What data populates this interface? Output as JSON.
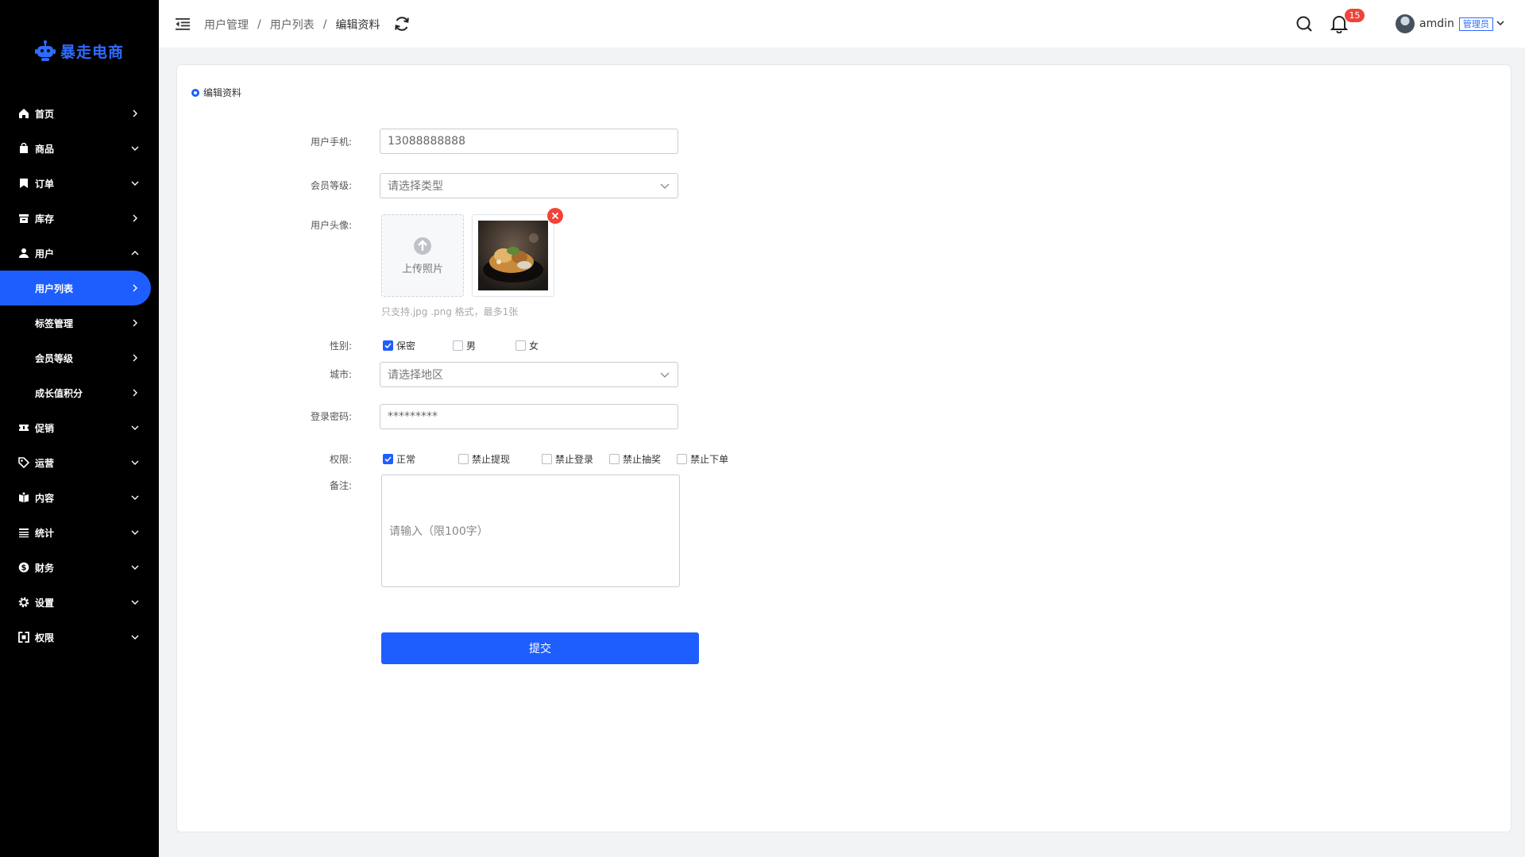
{
  "brand": {
    "name": "暴走电商",
    "color": "#2f6bff"
  },
  "sidebar": {
    "items": [
      {
        "label": "首页",
        "icon": "home-icon",
        "chevron": "right"
      },
      {
        "label": "商品",
        "icon": "bag-icon",
        "chevron": "down"
      },
      {
        "label": "订单",
        "icon": "bookmark-icon",
        "chevron": "down"
      },
      {
        "label": "库存",
        "icon": "inventory-icon",
        "chevron": "right"
      },
      {
        "label": "用户",
        "icon": "user-icon",
        "chevron": "up"
      },
      {
        "label": "用户列表",
        "sub": true,
        "active": true,
        "chevron": "right"
      },
      {
        "label": "标签管理",
        "sub": true,
        "chevron": "right"
      },
      {
        "label": "会员等级",
        "sub": true,
        "chevron": "right"
      },
      {
        "label": "成长值积分",
        "sub": true,
        "chevron": "right"
      },
      {
        "label": "促销",
        "icon": "ticket-icon",
        "chevron": "down"
      },
      {
        "label": "运营",
        "icon": "tag-icon",
        "chevron": "down"
      },
      {
        "label": "内容",
        "icon": "book-icon",
        "chevron": "down"
      },
      {
        "label": "统计",
        "icon": "table-icon",
        "chevron": "down"
      },
      {
        "label": "财务",
        "icon": "dollar-icon",
        "chevron": "down"
      },
      {
        "label": "设置",
        "icon": "gear-icon",
        "chevron": "down"
      },
      {
        "label": "权限",
        "icon": "permission-icon",
        "chevron": "down"
      }
    ]
  },
  "header": {
    "breadcrumb": [
      "用户管理",
      "用户列表",
      "编辑资料"
    ],
    "notification_count": "15",
    "username": "amdin",
    "role": "管理员"
  },
  "form": {
    "section_title": "编辑资料",
    "phone_label": "用户手机:",
    "phone_value": "13088888888",
    "level_label": "会员等级:",
    "level_placeholder": "请选择类型",
    "avatar_label": "用户头像:",
    "upload_label": "上传照片",
    "upload_hint": "只支持.jpg .png 格式，最多1张",
    "gender_label": "性别:",
    "gender_options": [
      {
        "label": "保密",
        "checked": true
      },
      {
        "label": "男",
        "checked": false
      },
      {
        "label": "女",
        "checked": false
      }
    ],
    "city_label": "城市:",
    "city_placeholder": "请选择地区",
    "password_label": "登录密码:",
    "password_value": "*********",
    "permission_label": "权限:",
    "permission_options": [
      {
        "label": "正常",
        "checked": true
      },
      {
        "label": "禁止提现",
        "checked": false
      },
      {
        "label": "禁止登录",
        "checked": false
      },
      {
        "label": "禁止抽奖",
        "checked": false
      },
      {
        "label": "禁止下单",
        "checked": false
      }
    ],
    "remark_label": "备注:",
    "remark_placeholder": "请输入（限100字）",
    "submit_label": "提交"
  },
  "colors": {
    "accent": "#1e5eff",
    "sidebar_bg": "#000000",
    "badge": "#f0443a"
  }
}
